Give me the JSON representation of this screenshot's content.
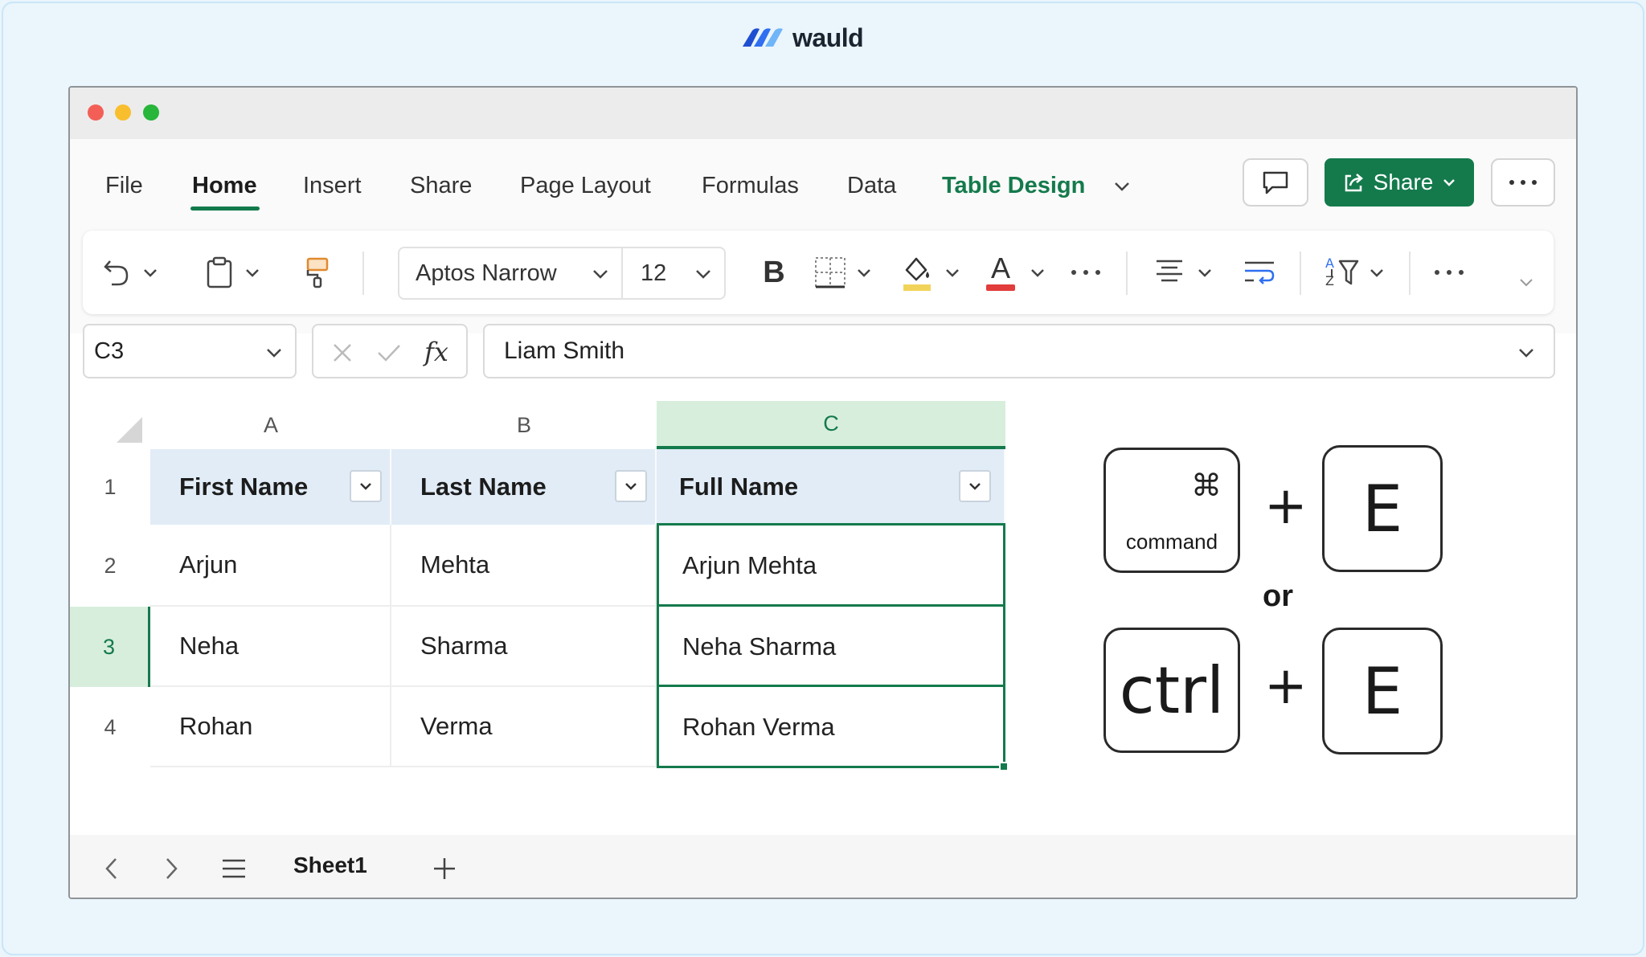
{
  "brand": {
    "name": "wauld"
  },
  "menu": {
    "items": [
      "File",
      "Home",
      "Insert",
      "Share",
      "Page Layout",
      "Formulas",
      "Data",
      "Table Design"
    ],
    "share_label": "Share"
  },
  "toolbar": {
    "font_name": "Aptos Narrow",
    "font_size": "12",
    "bold_label": "B",
    "font_color_label": "A"
  },
  "formula_bar": {
    "name_box": "C3",
    "fx_label": "fx",
    "value": "Liam Smith"
  },
  "grid": {
    "columns": [
      "A",
      "B",
      "C"
    ],
    "rows": [
      "1",
      "2",
      "3",
      "4"
    ],
    "headers": [
      "First Name",
      "Last Name",
      "Full Name"
    ],
    "data": [
      [
        "Arjun",
        "Mehta",
        "Arjun Mehta"
      ],
      [
        "Neha",
        "Sharma",
        "Neha Sharma"
      ],
      [
        "Rohan",
        "Verma",
        "Rohan Verma"
      ]
    ]
  },
  "shortcut": {
    "mac_symbol": "⌘",
    "mac_label": "command",
    "plus": "+",
    "key": "E",
    "or": "or",
    "win_label": "ctrl"
  },
  "sheets": {
    "active": "Sheet1"
  },
  "colors": {
    "accent": "#147a4c",
    "header_fill": "#e1ecf7",
    "selected_header": "#d8eedd"
  }
}
